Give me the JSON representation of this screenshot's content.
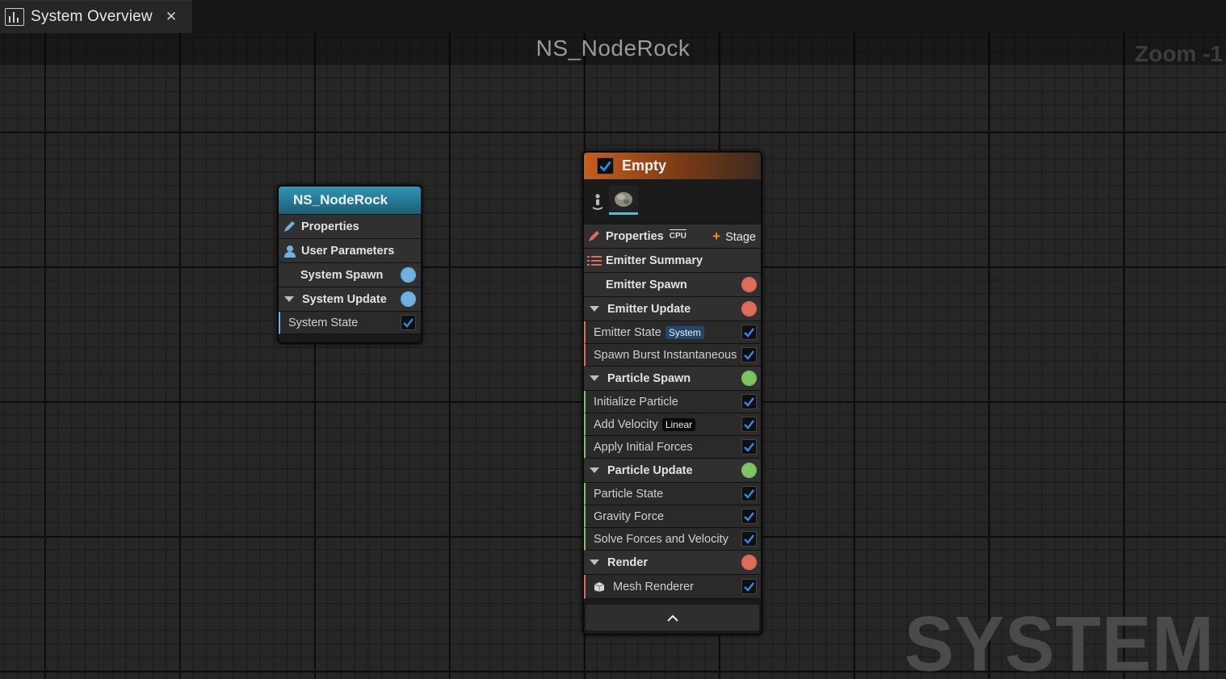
{
  "tab": {
    "title": "System Overview",
    "close": "✕",
    "icon": "chart-icon"
  },
  "graph": {
    "title": "NS_NodeRock",
    "zoom": "Zoom -1",
    "watermark": "SYSTEM"
  },
  "system_node": {
    "title": "NS_NodeRock",
    "rows": {
      "properties": "Properties",
      "user_parameters": "User Parameters",
      "system_spawn": "System Spawn",
      "system_update": "System Update",
      "system_state": "System State"
    }
  },
  "emitter_node": {
    "title": "Empty",
    "enabled": true,
    "properties": "Properties",
    "sim_target": "CPU",
    "stage_button": "Stage",
    "emitter_summary": "Emitter Summary",
    "emitter_spawn": "Emitter Spawn",
    "emitter_update": "Emitter Update",
    "emitter_update_modules": [
      {
        "label": "Emitter State",
        "tag": "System"
      },
      {
        "label": "Spawn Burst Instantaneous"
      }
    ],
    "particle_spawn": "Particle Spawn",
    "particle_spawn_modules": [
      {
        "label": "Initialize Particle"
      },
      {
        "label": "Add Velocity",
        "tag": "Linear"
      },
      {
        "label": "Apply Initial Forces"
      }
    ],
    "particle_update": "Particle Update",
    "particle_update_modules": [
      {
        "label": "Particle State"
      },
      {
        "label": "Gravity Force"
      },
      {
        "label": "Solve Forces and Velocity"
      }
    ],
    "render": "Render",
    "render_modules": [
      {
        "label": "Mesh Renderer"
      }
    ]
  },
  "colors": {
    "system_header": "#2a7f9a",
    "emitter_header": "#b0561f",
    "spawn_accent": "#e06b5a",
    "particle_accent": "#7fc463",
    "system_accent": "#6fb1e0",
    "check_blue": "#2a8cf0"
  }
}
